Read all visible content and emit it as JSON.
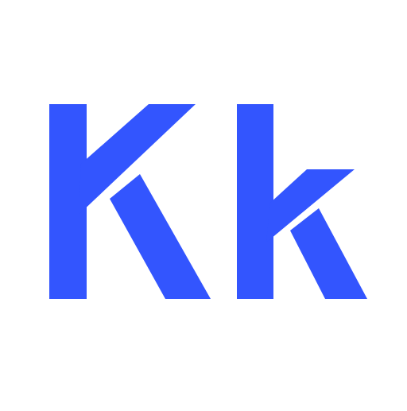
{
  "glyphs": {
    "text": "Kk",
    "color": "#3355fe",
    "uppercase": "K",
    "lowercase": "k"
  }
}
